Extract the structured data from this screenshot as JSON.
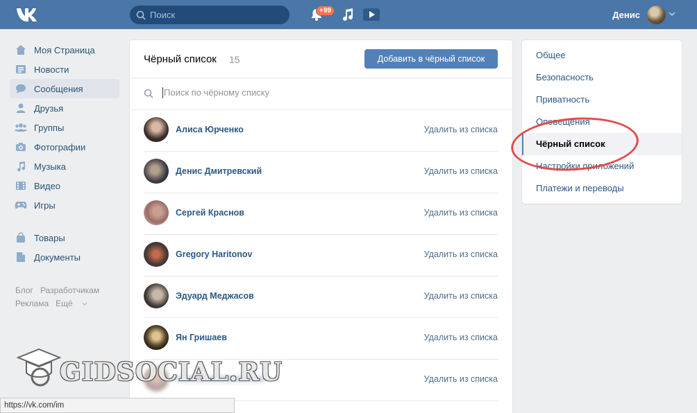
{
  "header": {
    "search_placeholder": "Поиск",
    "notifications_badge": "+99",
    "user_name": "Денис"
  },
  "leftnav": {
    "items": [
      {
        "label": "Моя Страница",
        "icon": "home-icon"
      },
      {
        "label": "Новости",
        "icon": "news-icon"
      },
      {
        "label": "Сообщения",
        "icon": "messages-icon",
        "active": true
      },
      {
        "label": "Друзья",
        "icon": "friends-icon"
      },
      {
        "label": "Группы",
        "icon": "groups-icon"
      },
      {
        "label": "Фотографии",
        "icon": "camera-icon"
      },
      {
        "label": "Музыка",
        "icon": "music-icon"
      },
      {
        "label": "Видео",
        "icon": "video-icon"
      },
      {
        "label": "Игры",
        "icon": "gamepad-icon"
      }
    ],
    "items2": [
      {
        "label": "Товары",
        "icon": "bag-icon"
      },
      {
        "label": "Документы",
        "icon": "document-icon"
      }
    ],
    "footer": [
      "Блог",
      "Разработчикам",
      "Реклама",
      "Ещё"
    ]
  },
  "main": {
    "title": "Чёрный список",
    "count": "15",
    "add_button": "Добавить в чёрный список",
    "search_placeholder": "Поиск по чёрному списку",
    "remove_label": "Удалить из списка",
    "rows": [
      {
        "name": "Алиса Юрченко"
      },
      {
        "name": "Денис Дмитревский"
      },
      {
        "name": "Сергей Краснов"
      },
      {
        "name": "Gregory Haritonov"
      },
      {
        "name": "Эдуард Меджасов"
      },
      {
        "name": "Ян Гришаев"
      }
    ]
  },
  "settings_menu": {
    "items": [
      "Общее",
      "Безопасность",
      "Приватность",
      "Оповещения",
      "Чёрный список",
      "Настройки приложений",
      "Платежи и переводы"
    ],
    "active_index": 4
  },
  "statusbar": "https://vk.com/im",
  "watermark": "GIDSOCIAL.RU",
  "colors": {
    "header_bg": "#4a76a8",
    "page_bg": "#edeef0",
    "button_bg": "#5181b8",
    "link": "#2a5885",
    "highlight_ring": "#e34b4b"
  }
}
